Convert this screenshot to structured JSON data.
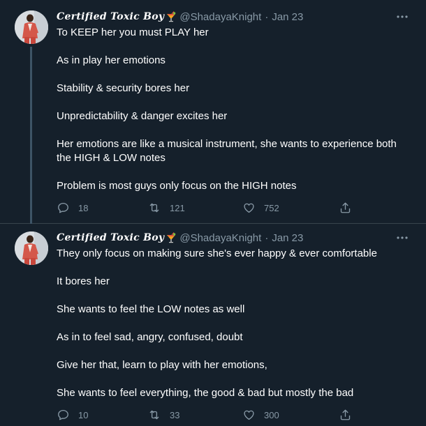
{
  "tweets": [
    {
      "display_name": "Certified Toxic Boy",
      "handle": "@ShadayaKnight",
      "separator": "·",
      "date": "Jan 23",
      "paragraphs": [
        "To KEEP her you must PLAY her",
        "As in play her emotions",
        "Stability & security bores her",
        "Unpredictability & danger excites her",
        "Her emotions are like a musical instrument, she wants to experience both the HIGH & LOW notes",
        "Problem is most guys only focus on the HIGH notes"
      ],
      "replies": "18",
      "retweets": "121",
      "likes": "752"
    },
    {
      "display_name": "Certified Toxic Boy",
      "handle": "@ShadayaKnight",
      "separator": "·",
      "date": "Jan 23",
      "paragraphs": [
        "They only focus on making sure she's ever happy & ever comfortable",
        "It bores her",
        "She wants to feel the LOW notes as well",
        "As in to feel sad, angry, confused, doubt",
        "Give her that, learn to play with her emotions,",
        "She wants to feel everything, the good & bad but mostly the bad"
      ],
      "replies": "10",
      "retweets": "33",
      "likes": "300"
    }
  ],
  "icons": {
    "more": "more-horizontal-icon",
    "reply": "reply-icon",
    "retweet": "retweet-icon",
    "like": "heart-icon",
    "share": "share-icon",
    "emoji": "tropical-drink-emoji"
  },
  "colors": {
    "background": "#15202b",
    "text": "#ffffff",
    "secondary_text": "#8899a6",
    "divider": "#38444d",
    "thread_line": "#3d5466"
  }
}
